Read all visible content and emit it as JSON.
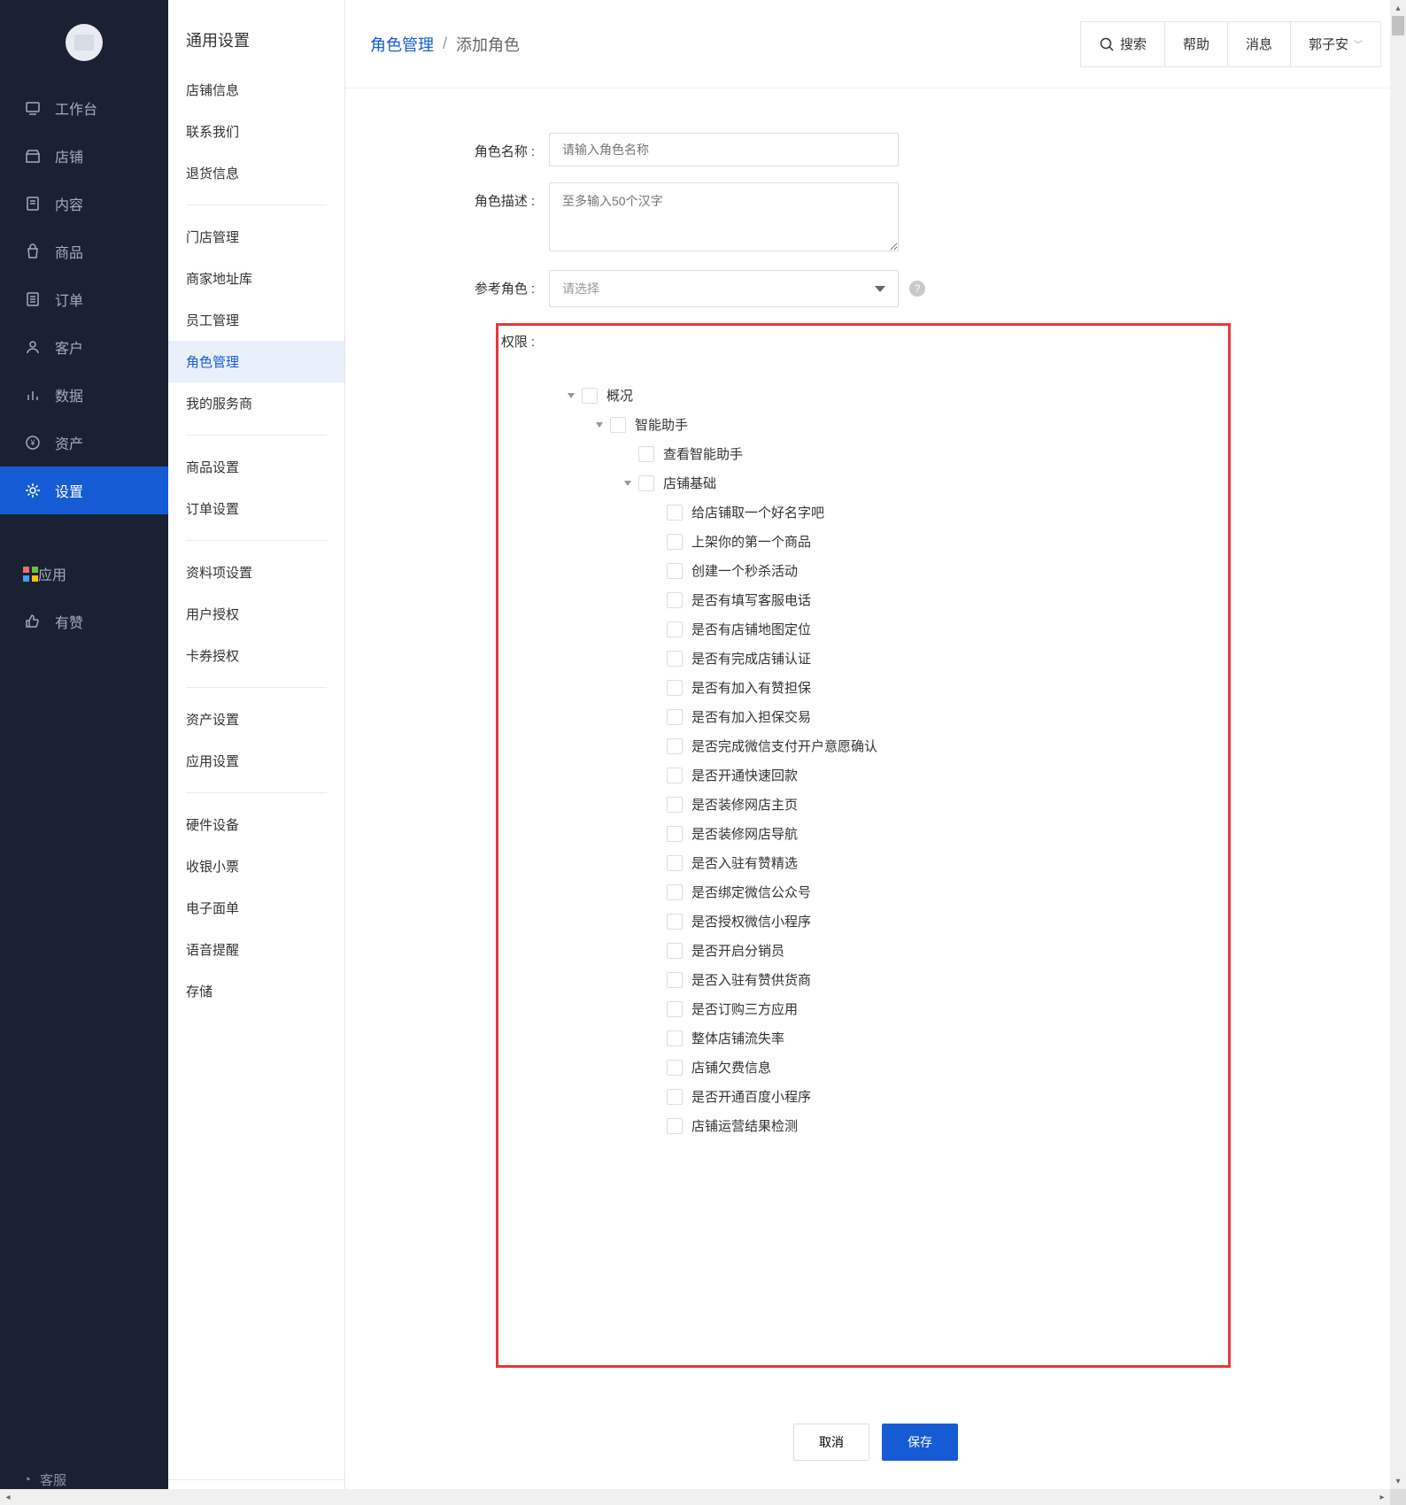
{
  "primary_nav": {
    "items": [
      {
        "label": "工作台",
        "icon": "monitor-icon"
      },
      {
        "label": "店铺",
        "icon": "store-icon"
      },
      {
        "label": "内容",
        "icon": "document-icon"
      },
      {
        "label": "商品",
        "icon": "bag-icon"
      },
      {
        "label": "订单",
        "icon": "list-icon"
      },
      {
        "label": "客户",
        "icon": "user-icon"
      },
      {
        "label": "数据",
        "icon": "chart-icon"
      },
      {
        "label": "资产",
        "icon": "coin-icon"
      },
      {
        "label": "设置",
        "icon": "gear-icon",
        "active": true
      }
    ],
    "extra": [
      {
        "label": "应用",
        "icon": "apps-icon"
      },
      {
        "label": "有赞",
        "icon": "thumb-icon"
      }
    ],
    "customer_service": "客服"
  },
  "secondary_nav": {
    "title": "通用设置",
    "groups": [
      [
        "店铺信息",
        "联系我们",
        "退货信息"
      ],
      [
        "门店管理",
        "商家地址库",
        "员工管理",
        "角色管理",
        "我的服务商"
      ],
      [
        "商品设置",
        "订单设置"
      ],
      [
        "资料项设置",
        "用户授权",
        "卡券授权"
      ],
      [
        "资产设置",
        "应用设置"
      ],
      [
        "硬件设备",
        "收银小票",
        "电子面单",
        "语音提醒",
        "存储"
      ]
    ],
    "active": "角色管理"
  },
  "topbar": {
    "breadcrumb_parent": "角色管理",
    "breadcrumb_current": "添加角色",
    "search": "搜索",
    "help": "帮助",
    "messages": "消息",
    "user": "郭子安"
  },
  "form": {
    "role_name_label": "角色名称",
    "role_name_placeholder": "请输入角色名称",
    "role_desc_label": "角色描述",
    "role_desc_placeholder": "至多输入50个汉字",
    "ref_role_label": "参考角色",
    "ref_role_placeholder": "请选择",
    "perm_label": "权限"
  },
  "perm_tree": [
    {
      "level": 0,
      "expandable": true,
      "label": "概况"
    },
    {
      "level": 1,
      "expandable": true,
      "label": "智能助手"
    },
    {
      "level": 2,
      "expandable": false,
      "label": "查看智能助手"
    },
    {
      "level": 2,
      "expandable": true,
      "label": "店铺基础"
    },
    {
      "level": 3,
      "expandable": false,
      "label": "给店铺取一个好名字吧"
    },
    {
      "level": 3,
      "expandable": false,
      "label": "上架你的第一个商品"
    },
    {
      "level": 3,
      "expandable": false,
      "label": "创建一个秒杀活动"
    },
    {
      "level": 3,
      "expandable": false,
      "label": "是否有填写客服电话"
    },
    {
      "level": 3,
      "expandable": false,
      "label": "是否有店铺地图定位"
    },
    {
      "level": 3,
      "expandable": false,
      "label": "是否有完成店铺认证"
    },
    {
      "level": 3,
      "expandable": false,
      "label": "是否有加入有赞担保"
    },
    {
      "level": 3,
      "expandable": false,
      "label": "是否有加入担保交易"
    },
    {
      "level": 3,
      "expandable": false,
      "label": "是否完成微信支付开户意愿确认"
    },
    {
      "level": 3,
      "expandable": false,
      "label": "是否开通快速回款"
    },
    {
      "level": 3,
      "expandable": false,
      "label": "是否装修网店主页"
    },
    {
      "level": 3,
      "expandable": false,
      "label": "是否装修网店导航"
    },
    {
      "level": 3,
      "expandable": false,
      "label": "是否入驻有赞精选"
    },
    {
      "level": 3,
      "expandable": false,
      "label": "是否绑定微信公众号"
    },
    {
      "level": 3,
      "expandable": false,
      "label": "是否授权微信小程序"
    },
    {
      "level": 3,
      "expandable": false,
      "label": "是否开启分销员"
    },
    {
      "level": 3,
      "expandable": false,
      "label": "是否入驻有赞供货商"
    },
    {
      "level": 3,
      "expandable": false,
      "label": "是否订购三方应用"
    },
    {
      "level": 3,
      "expandable": false,
      "label": "整体店铺流失率"
    },
    {
      "level": 3,
      "expandable": false,
      "label": "店铺欠费信息"
    },
    {
      "level": 3,
      "expandable": false,
      "label": "是否开通百度小程序"
    },
    {
      "level": 3,
      "expandable": false,
      "label": "店铺运营结果检测"
    }
  ],
  "footer": {
    "cancel": "取消",
    "save": "保存"
  }
}
